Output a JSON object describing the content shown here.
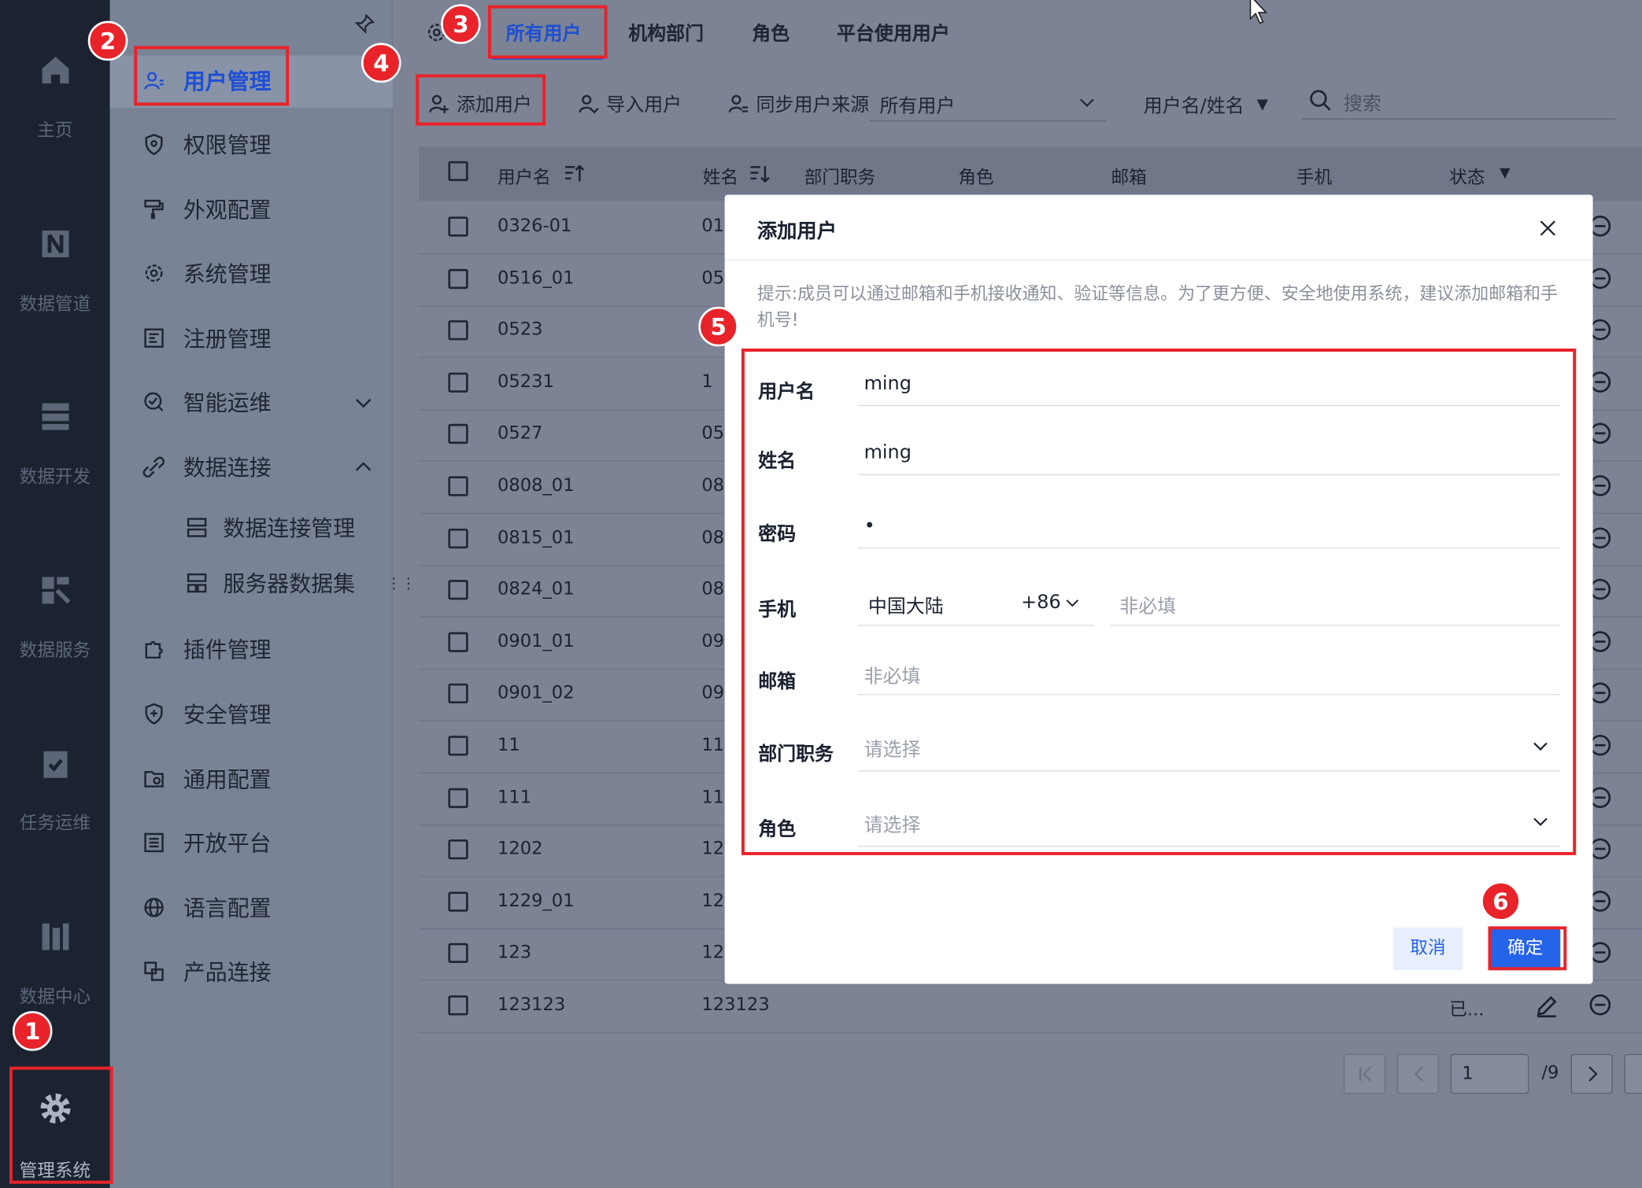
{
  "rail": {
    "items": [
      {
        "label": "主页",
        "icon": "home-icon"
      },
      {
        "label": "数据管道",
        "icon": "pipeline-icon"
      },
      {
        "label": "数据开发",
        "icon": "dev-icon"
      },
      {
        "label": "数据服务",
        "icon": "service-icon"
      },
      {
        "label": "任务运维",
        "icon": "task-icon"
      },
      {
        "label": "数据中心",
        "icon": "datacenter-icon"
      },
      {
        "label": "管理系统",
        "icon": "gear-icon"
      }
    ]
  },
  "sidebar": {
    "items": [
      {
        "label": "用户管理"
      },
      {
        "label": "权限管理"
      },
      {
        "label": "外观配置"
      },
      {
        "label": "系统管理"
      },
      {
        "label": "注册管理"
      },
      {
        "label": "智能运维"
      },
      {
        "label": "数据连接"
      },
      {
        "label": "插件管理"
      },
      {
        "label": "安全管理"
      },
      {
        "label": "通用配置"
      },
      {
        "label": "开放平台"
      },
      {
        "label": "语言配置"
      },
      {
        "label": "产品连接"
      }
    ],
    "sub_items": [
      {
        "label": "数据连接管理"
      },
      {
        "label": "服务器数据集"
      }
    ]
  },
  "tabs": [
    {
      "label": "所有用户"
    },
    {
      "label": "机构部门"
    },
    {
      "label": "角色"
    },
    {
      "label": "平台使用用户"
    }
  ],
  "toolbar": {
    "add_user": "添加用户",
    "import_user": "导入用户",
    "sync_source": "同步用户来源",
    "filter_value": "所有用户",
    "search_field": "用户名/姓名",
    "search_placeholder": "搜索"
  },
  "table": {
    "headers": [
      "用户名",
      "姓名",
      "部门职务",
      "角色",
      "邮箱",
      "手机",
      "状态"
    ],
    "rows": [
      {
        "user": "0326-01",
        "name": "01"
      },
      {
        "user": "0516_01",
        "name": "05"
      },
      {
        "user": "0523",
        "name": ""
      },
      {
        "user": "05231",
        "name": "1"
      },
      {
        "user": "0527",
        "name": "05"
      },
      {
        "user": "0808_01",
        "name": "08"
      },
      {
        "user": "0815_01",
        "name": "08"
      },
      {
        "user": "0824_01",
        "name": "08"
      },
      {
        "user": "0901_01",
        "name": "09"
      },
      {
        "user": "0901_02",
        "name": "09"
      },
      {
        "user": "11",
        "name": "11"
      },
      {
        "user": "111",
        "name": "11"
      },
      {
        "user": "1202",
        "name": "12"
      },
      {
        "user": "1229_01",
        "name": "12"
      },
      {
        "user": "123",
        "name": "12"
      },
      {
        "user": "123123",
        "name": "123123",
        "status": "已..."
      }
    ]
  },
  "pagination": {
    "page": "1",
    "total": "/9"
  },
  "modal": {
    "title": "添加用户",
    "hint": "提示:成员可以通过邮箱和手机接收通知、验证等信息。为了更方便、安全地使用系统，建议添加邮箱和手机号!",
    "fields": {
      "username_label": "用户名",
      "username_value": "ming",
      "realname_label": "姓名",
      "realname_value": "ming",
      "password_label": "密码",
      "password_value": "•",
      "phone_label": "手机",
      "phone_region": "中国大陆",
      "phone_code": "+86",
      "phone_placeholder": "非必填",
      "email_label": "邮箱",
      "email_placeholder": "非必填",
      "dept_label": "部门职务",
      "dept_placeholder": "请选择",
      "role_label": "角色",
      "role_placeholder": "请选择"
    },
    "cancel": "取消",
    "confirm": "确定"
  },
  "badges": [
    "1",
    "2",
    "3",
    "4",
    "5",
    "6"
  ],
  "colors": {
    "highlight": "#e8232a",
    "primary": "#2563e8",
    "rail_bg": "#1b2331"
  }
}
